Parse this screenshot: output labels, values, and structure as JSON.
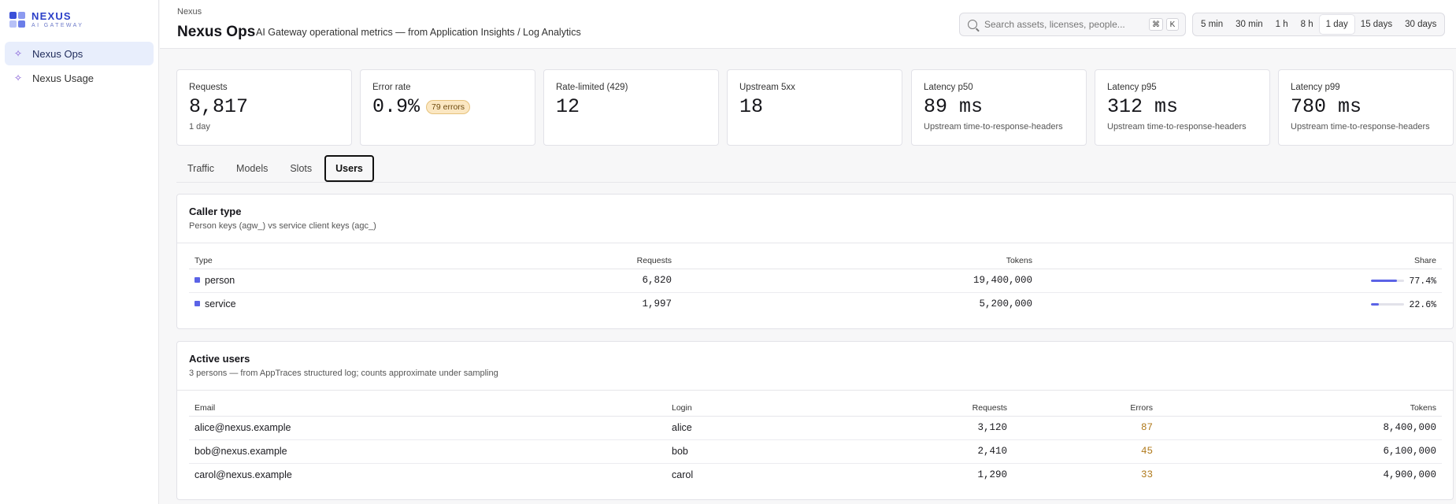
{
  "brand": {
    "name": "NEXUS",
    "tagline": "AI GATEWAY",
    "logo_colors": [
      "#3a4fd8",
      "#8c9af0",
      "#b7c1f7",
      "#6b7ee9"
    ]
  },
  "sidebar": {
    "items": [
      {
        "label": "Nexus Ops",
        "icon": "sparkle-icon",
        "active": true
      },
      {
        "label": "Nexus Usage",
        "icon": "sparkle-icon",
        "active": false
      }
    ]
  },
  "header": {
    "breadcrumb": "Nexus",
    "title": "Nexus Ops",
    "subtitle": "AI Gateway operational metrics — from Application Insights / Log Analytics",
    "search_placeholder": "Search assets, licenses, people...",
    "shortcut": [
      "⌘",
      "K"
    ],
    "ranges": [
      "5 min",
      "30 min",
      "1 h",
      "8 h",
      "1 day",
      "15 days",
      "30 days"
    ],
    "active_range": "1 day"
  },
  "kpis": [
    {
      "label": "Requests",
      "value": "8,817",
      "note": "1 day"
    },
    {
      "label": "Error rate",
      "value": "0.9%",
      "badge": "79 errors",
      "note": ""
    },
    {
      "label": "Rate-limited (429)",
      "value": "12",
      "note": ""
    },
    {
      "label": "Upstream 5xx",
      "value": "18",
      "note": ""
    },
    {
      "label": "Latency p50",
      "value": "89 ms",
      "note": "Upstream time-to-response-headers"
    },
    {
      "label": "Latency p95",
      "value": "312 ms",
      "note": "Upstream time-to-response-headers"
    },
    {
      "label": "Latency p99",
      "value": "780 ms",
      "note": "Upstream time-to-response-headers"
    }
  ],
  "tabs": [
    "Traffic",
    "Models",
    "Slots",
    "Users"
  ],
  "active_tab": "Users",
  "caller_type": {
    "title": "Caller type",
    "subtitle": "Person keys (agw_) vs service client keys (agc_)",
    "columns": [
      "Type",
      "Requests",
      "Tokens",
      "Share"
    ],
    "rows": [
      {
        "type": "person",
        "requests": "6,820",
        "tokens": "19,400,000",
        "share": "77.4%",
        "share_value": 0.774
      },
      {
        "type": "service",
        "requests": "1,997",
        "tokens": "5,200,000",
        "share": "22.6%",
        "share_value": 0.226
      }
    ],
    "accent": "#5b63e6"
  },
  "active_users": {
    "title": "Active users",
    "subtitle": "3 persons — from AppTraces structured log; counts approximate under sampling",
    "columns": [
      "Email",
      "Login",
      "Requests",
      "Errors",
      "Tokens"
    ],
    "rows": [
      {
        "email": "alice@nexus.example",
        "login": "alice",
        "requests": "3,120",
        "errors": "87",
        "tokens": "8,400,000"
      },
      {
        "email": "bob@nexus.example",
        "login": "bob",
        "requests": "2,410",
        "errors": "45",
        "tokens": "6,100,000"
      },
      {
        "email": "carol@nexus.example",
        "login": "carol",
        "requests": "1,290",
        "errors": "33",
        "tokens": "4,900,000"
      }
    ],
    "error_color": "#b07a1c"
  }
}
